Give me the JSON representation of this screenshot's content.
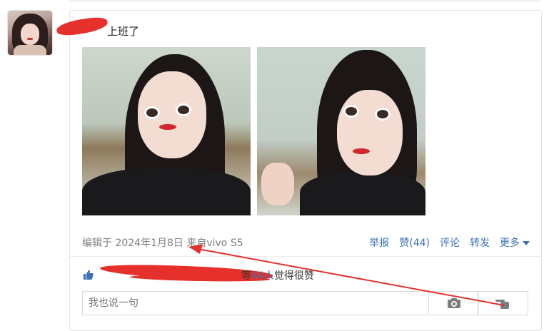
{
  "post": {
    "text": "上班了",
    "meta": "编辑于 2024年1月8日  来自vivo S5"
  },
  "actions": {
    "report": "举报",
    "like": "赞(44)",
    "comment": "评论",
    "repost": "转发",
    "more": "更多"
  },
  "likes": {
    "suffix_pre": "等",
    "count": "44人",
    "suffix_post": "觉得很赞"
  },
  "comment_box": {
    "placeholder": "我也说一句"
  },
  "colors": {
    "link": "#3b6fb6",
    "annotation_red": "#e5302b"
  },
  "icons": {
    "like": "thumbs-up-icon",
    "camera": "camera-icon",
    "hand": "pointing-hand-icon",
    "more": "caret-down-icon"
  }
}
